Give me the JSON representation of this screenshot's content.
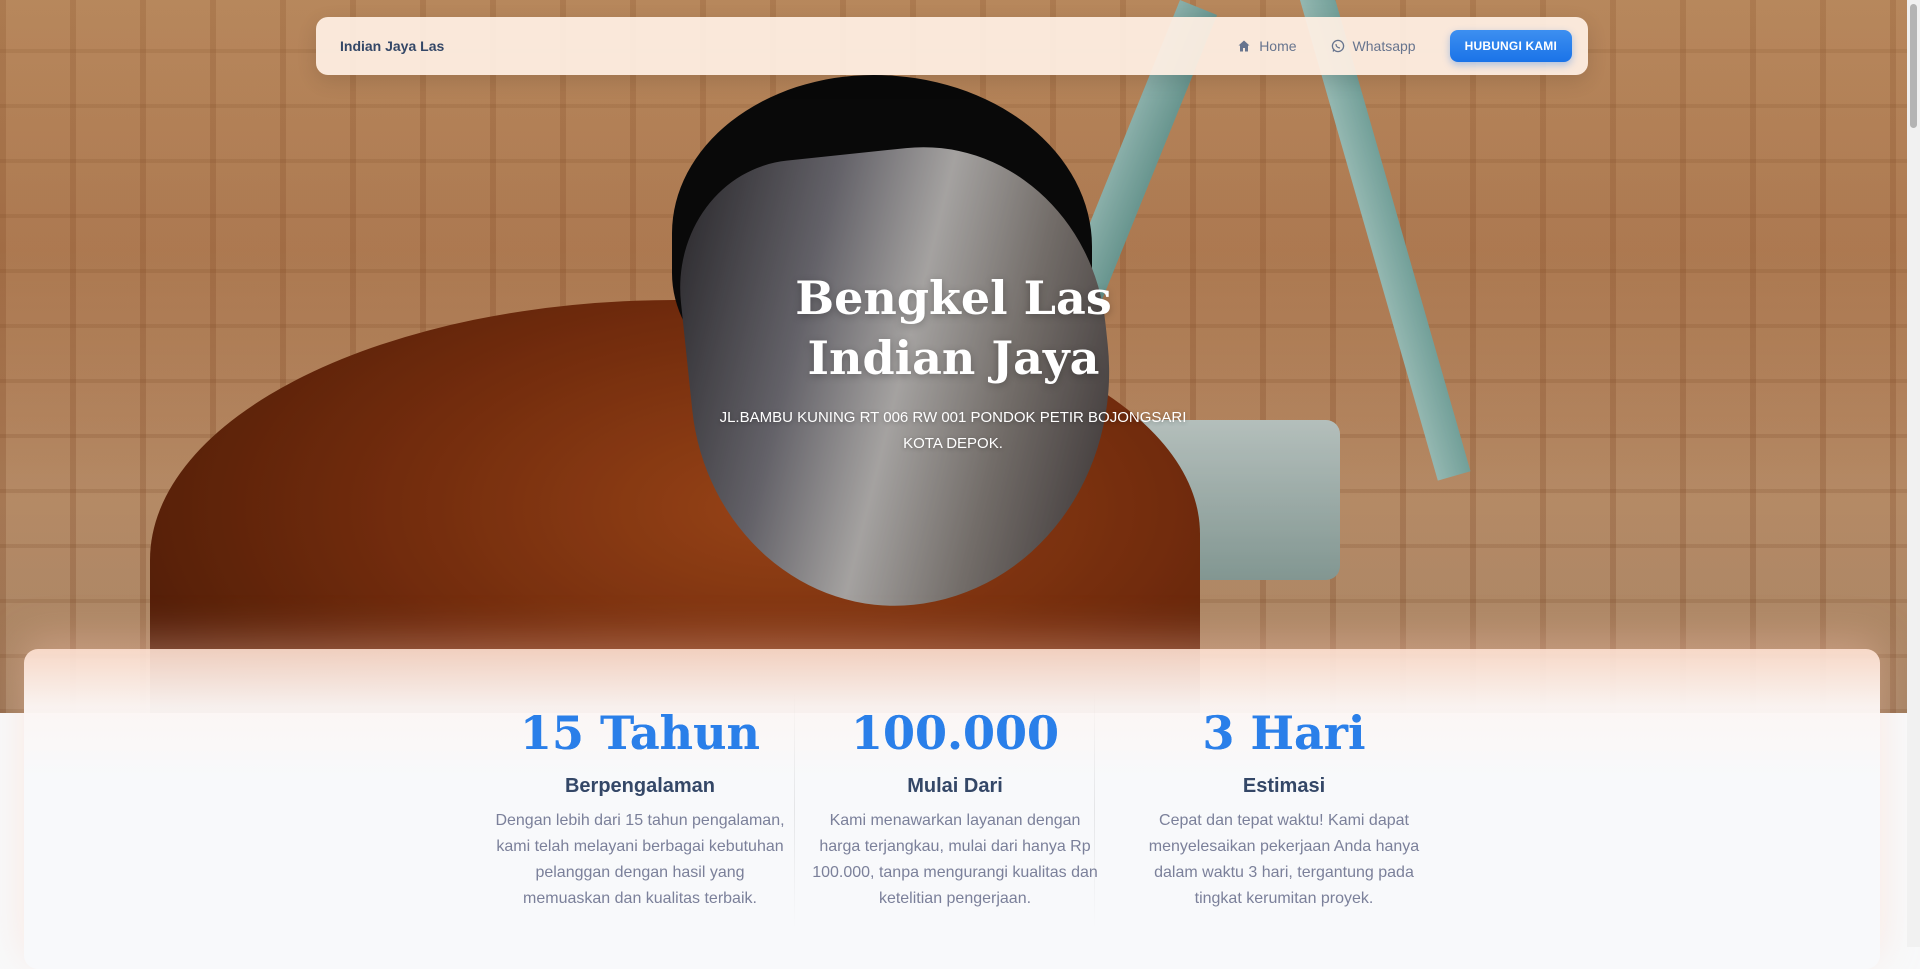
{
  "navbar": {
    "brand": "Indian Jaya Las",
    "links": [
      {
        "label": "Home",
        "icon": "home-icon"
      },
      {
        "label": "Whatsapp",
        "icon": "whatsapp-icon"
      }
    ],
    "cta_label": "HUBUNGI KAMI"
  },
  "hero": {
    "title_line1": "Bengkel Las",
    "title_line2": "Indian Jaya",
    "address": "JL.BAMBU KUNING RT 006 RW 001 PONDOK PETIR BOJONGSARI KOTA DEPOK."
  },
  "stats": [
    {
      "value": "15 Tahun",
      "label": "Berpengalaman",
      "description": "Dengan lebih dari 15 tahun pengalaman, kami telah melayani berbagai kebutuhan pelanggan dengan hasil yang memuaskan dan kualitas terbaik."
    },
    {
      "value": "100.000",
      "label": "Mulai Dari",
      "description": "Kami menawarkan layanan dengan harga terjangkau, mulai dari hanya Rp 100.000, tanpa mengurangi kualitas dan ketelitian pengerjaan."
    },
    {
      "value": "3 Hari",
      "label": "Estimasi",
      "description": "Cepat dan tepat waktu! Kami dapat menyelesaikan pekerjaan Anda hanya dalam waktu 3 hari, tergantung pada tingkat kerumitan proyek."
    }
  ],
  "colors": {
    "accent": "#1a73e8",
    "heading": "#344767",
    "muted": "#7b809a"
  }
}
